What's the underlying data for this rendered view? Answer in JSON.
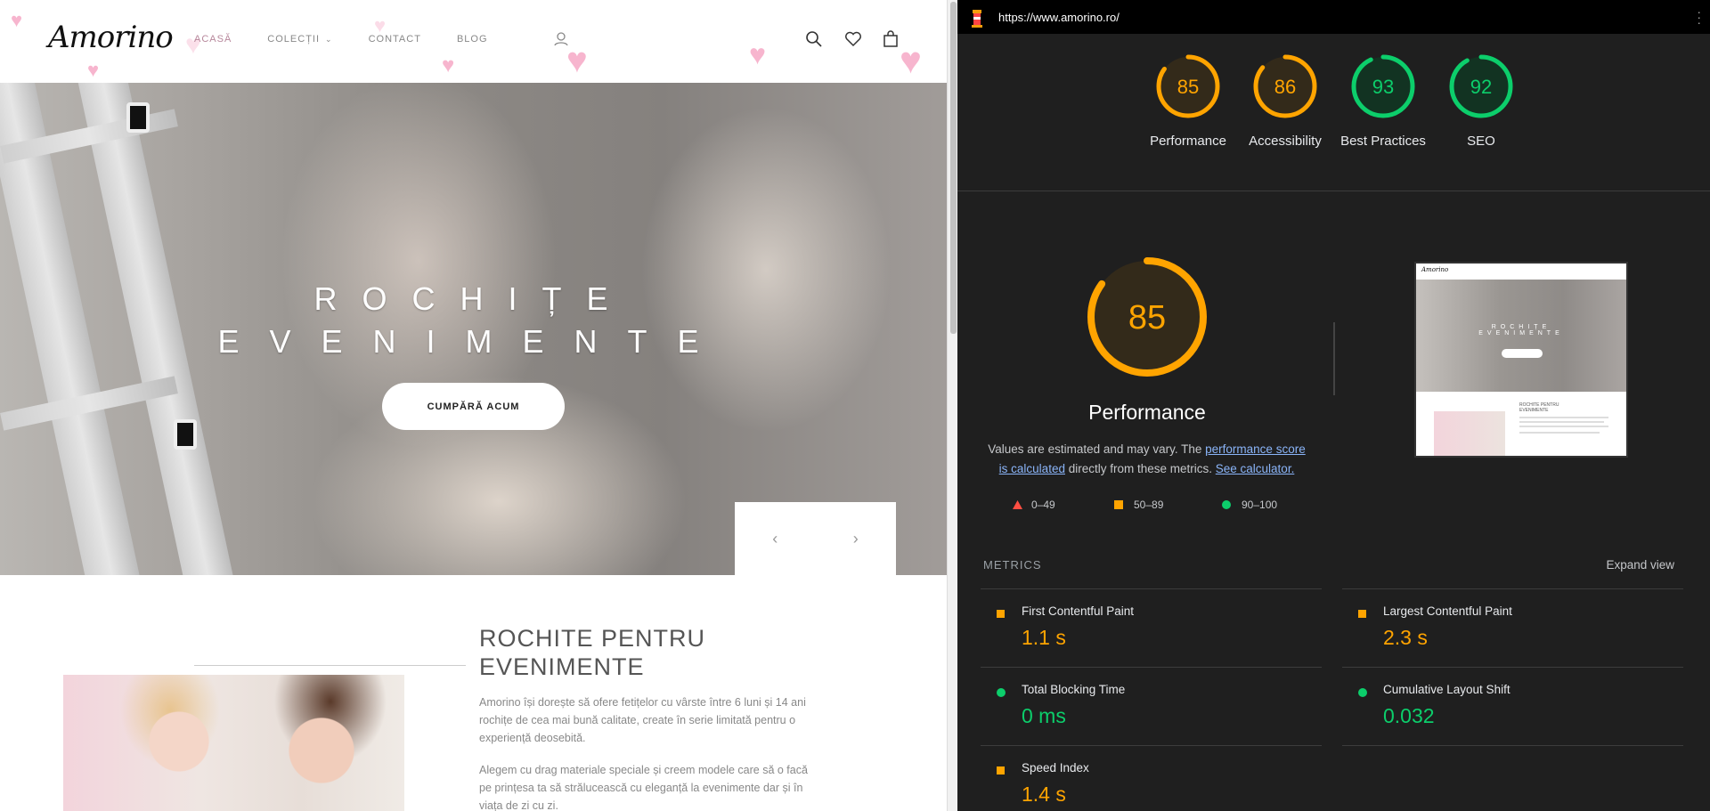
{
  "site": {
    "logo": "Amorino",
    "nav": [
      {
        "label": "ACASĂ"
      },
      {
        "label": "COLECȚII"
      },
      {
        "label": "CONTACT"
      },
      {
        "label": "BLOG"
      }
    ],
    "hero": {
      "title_line1": "ROCHIȚE",
      "title_line2": "EVENIMENTE",
      "cta": "CUMPĂRĂ ACUM",
      "prev": "‹",
      "next": "›"
    },
    "section": {
      "title_line1": "ROCHITE PENTRU",
      "title_line2": "EVENIMENTE",
      "p1": "Amorino își dorește să ofere fetițelor cu vârste între 6 luni și 14 ani rochițe de cea mai bună calitate, create în serie limitată pentru o experiență deosebită.",
      "p2": "Alegem cu drag materiale speciale și creem modele care să o facă pe prințesa ta să strălucească cu eleganță la evenimente dar și în viața de zi cu zi."
    }
  },
  "lighthouse": {
    "url": "https://www.amorino.ro/",
    "scores": [
      {
        "label": "Performance",
        "value": "85",
        "level": "average"
      },
      {
        "label": "Accessibility",
        "value": "86",
        "level": "average"
      },
      {
        "label": "Best Practices",
        "value": "93",
        "level": "pass"
      },
      {
        "label": "SEO",
        "value": "92",
        "level": "pass"
      }
    ],
    "main_score": "85",
    "main_title": "Performance",
    "desc_prefix": "Values are estimated and may vary. The ",
    "desc_link1": "performance score is calculated",
    "desc_mid": " directly from these metrics. ",
    "desc_link2": "See calculator.",
    "legend": [
      {
        "range": "0–49",
        "color": "#ff4e42"
      },
      {
        "range": "50–89",
        "color": "#ffa400"
      },
      {
        "range": "90–100",
        "color": "#0cce6b"
      }
    ],
    "metrics_header": "METRICS",
    "expand_label": "Expand view",
    "metrics": [
      {
        "name": "First Contentful Paint",
        "value": "1.1 s",
        "level": "orange"
      },
      {
        "name": "Largest Contentful Paint",
        "value": "2.3 s",
        "level": "orange"
      },
      {
        "name": "Total Blocking Time",
        "value": "0 ms",
        "level": "green"
      },
      {
        "name": "Cumulative Layout Shift",
        "value": "0.032",
        "level": "green"
      },
      {
        "name": "Speed Index",
        "value": "1.4 s",
        "level": "orange"
      }
    ],
    "colors": {
      "average": "#ffa400",
      "pass": "#0cce6b",
      "fail": "#ff4e42"
    }
  }
}
